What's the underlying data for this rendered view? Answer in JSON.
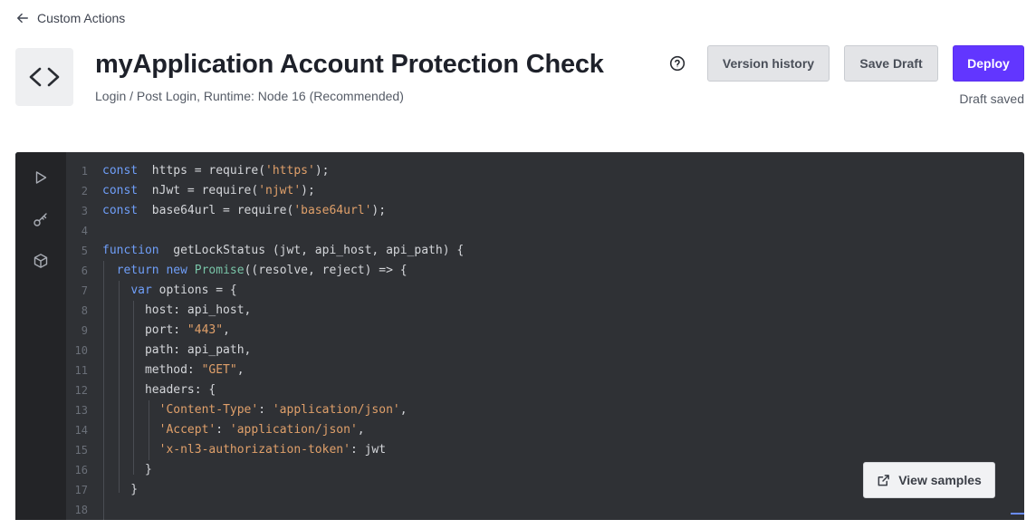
{
  "nav": {
    "back_label": "Custom Actions"
  },
  "header": {
    "title": "myApplication Account Protection Check",
    "subtitle": "Login / Post Login, Runtime: Node 16 (Recommended)",
    "icon": "code-brackets-icon"
  },
  "toolbar": {
    "version_history_label": "Version history",
    "save_draft_label": "Save Draft",
    "deploy_label": "Deploy",
    "draft_status": "Draft saved",
    "help_icon": "help-circle-icon"
  },
  "editor": {
    "sidebar": [
      {
        "name": "run-icon"
      },
      {
        "name": "key-icon"
      },
      {
        "name": "package-icon"
      }
    ],
    "lines": [
      {
        "n": "1",
        "tokens": [
          [
            "kw",
            "const"
          ],
          [
            "",
            "  https = require("
          ],
          [
            "str",
            "'https'"
          ],
          [
            "",
            ");"
          ]
        ]
      },
      {
        "n": "2",
        "tokens": [
          [
            "kw",
            "const"
          ],
          [
            "",
            "  nJwt = require("
          ],
          [
            "str",
            "'njwt'"
          ],
          [
            "",
            ");"
          ]
        ]
      },
      {
        "n": "3",
        "tokens": [
          [
            "kw",
            "const"
          ],
          [
            "",
            "  base64url = require("
          ],
          [
            "str",
            "'base64url'"
          ],
          [
            "",
            ");"
          ]
        ]
      },
      {
        "n": "4",
        "tokens": []
      },
      {
        "n": "5",
        "tokens": [
          [
            "kw",
            "function"
          ],
          [
            "",
            "  getLockStatus (jwt, api_host, api_path) {"
          ]
        ]
      },
      {
        "n": "6",
        "tokens": [
          [
            "",
            "  "
          ],
          [
            "kw",
            "return"
          ],
          [
            "",
            " "
          ],
          [
            "kw",
            "new"
          ],
          [
            "",
            " "
          ],
          [
            "cls",
            "Promise"
          ],
          [
            "",
            "((resolve, reject) => {"
          ]
        ]
      },
      {
        "n": "7",
        "tokens": [
          [
            "",
            "    "
          ],
          [
            "kw",
            "var"
          ],
          [
            "",
            " options = {"
          ]
        ]
      },
      {
        "n": "8",
        "tokens": [
          [
            "",
            "      host: api_host,"
          ]
        ]
      },
      {
        "n": "9",
        "tokens": [
          [
            "",
            "      port: "
          ],
          [
            "str",
            "\"443\""
          ],
          [
            "",
            ","
          ]
        ]
      },
      {
        "n": "10",
        "tokens": [
          [
            "",
            "      path: api_path,"
          ]
        ]
      },
      {
        "n": "11",
        "tokens": [
          [
            "",
            "      method: "
          ],
          [
            "str",
            "\"GET\""
          ],
          [
            "",
            ","
          ]
        ]
      },
      {
        "n": "12",
        "tokens": [
          [
            "",
            "      headers: {"
          ]
        ]
      },
      {
        "n": "13",
        "tokens": [
          [
            "",
            "        "
          ],
          [
            "str",
            "'Content-Type'"
          ],
          [
            "",
            ": "
          ],
          [
            "str",
            "'application/json'"
          ],
          [
            "",
            ","
          ]
        ]
      },
      {
        "n": "14",
        "tokens": [
          [
            "",
            "        "
          ],
          [
            "str",
            "'Accept'"
          ],
          [
            "",
            ": "
          ],
          [
            "str",
            "'application/json'"
          ],
          [
            "",
            ","
          ]
        ]
      },
      {
        "n": "15",
        "tokens": [
          [
            "",
            "        "
          ],
          [
            "str",
            "'x-nl3-authorization-token'"
          ],
          [
            "",
            ": jwt"
          ]
        ]
      },
      {
        "n": "16",
        "tokens": [
          [
            "",
            "      }"
          ]
        ]
      },
      {
        "n": "17",
        "tokens": [
          [
            "",
            "    }"
          ]
        ]
      },
      {
        "n": "18",
        "tokens": []
      }
    ]
  },
  "samples": {
    "label": "View samples",
    "icon": "external-link-icon"
  },
  "colors": {
    "accent": "#6236ff",
    "editor_bg": "#2f3135",
    "keyword": "#6f9ef8",
    "string": "#e0a06a"
  }
}
